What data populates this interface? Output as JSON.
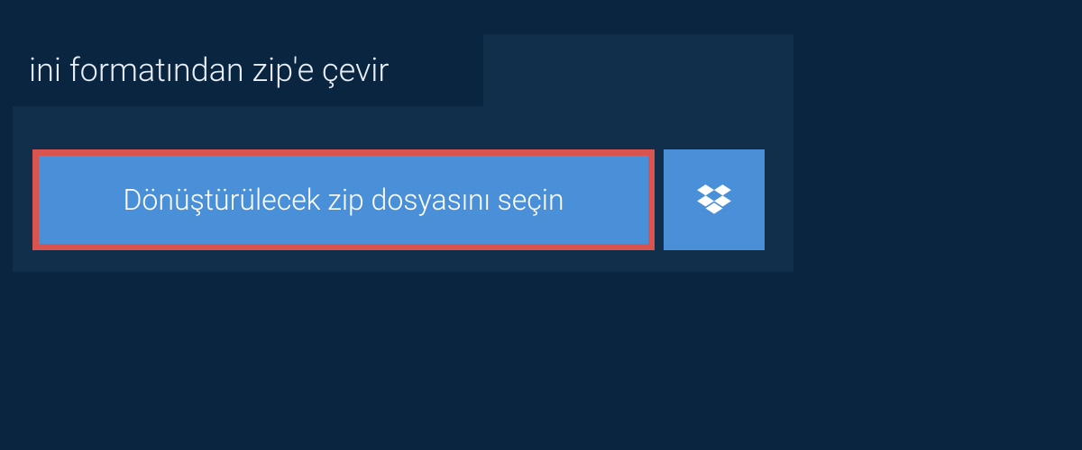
{
  "header": {
    "title": "ini formatından zip'e çevir"
  },
  "actions": {
    "file_select_label": "Dönüştürülecek zip dosyasını seçin",
    "dropbox_icon": "dropbox-icon"
  },
  "colors": {
    "page_bg": "#0a2540",
    "panel_bg": "#112e4a",
    "button_bg": "#4a90d9",
    "highlight_border": "#d9534f",
    "text_light": "#e8eef5",
    "text_white": "#ffffff"
  }
}
